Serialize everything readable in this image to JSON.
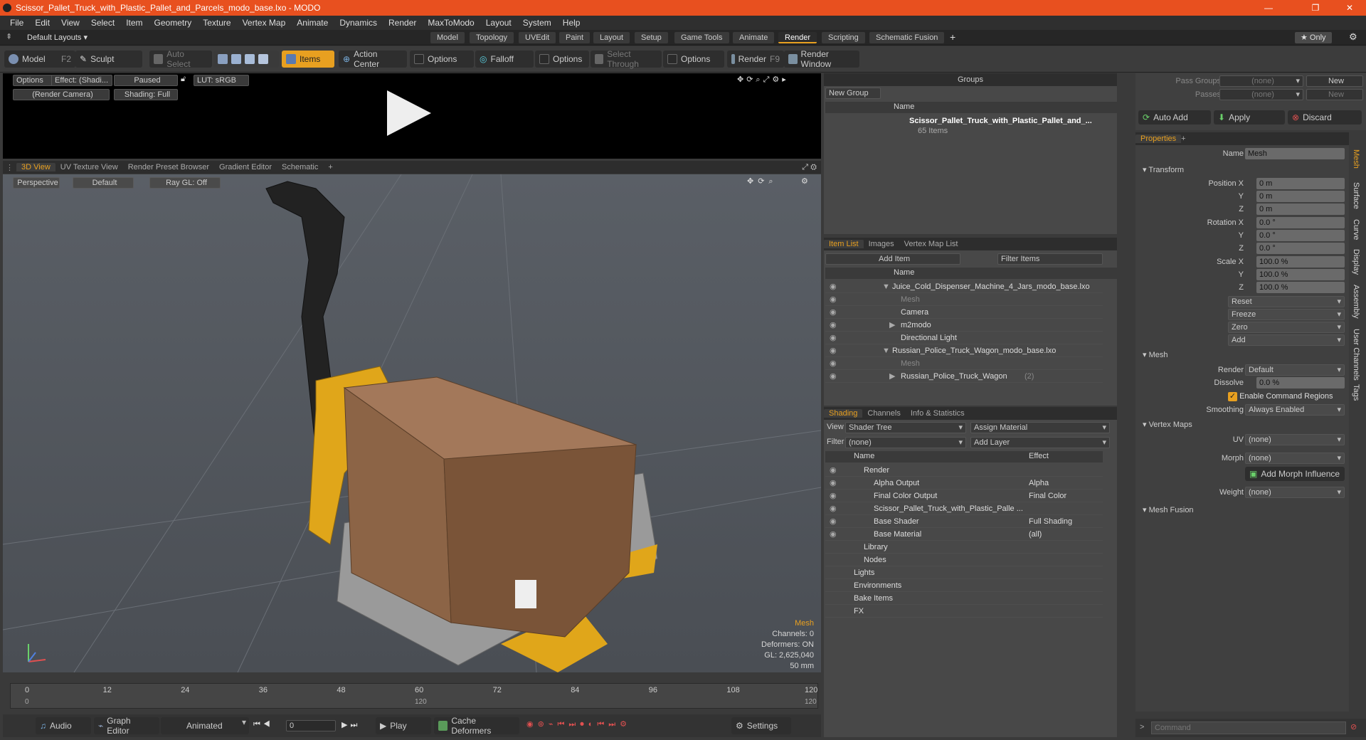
{
  "window": {
    "title": "Scissor_Pallet_Truck_with_Plastic_Pallet_and_Parcels_modo_base.lxo - MODO",
    "min": "—",
    "max": "❐",
    "close": "✕"
  },
  "menu": [
    "File",
    "Edit",
    "View",
    "Select",
    "Item",
    "Geometry",
    "Texture",
    "Vertex Map",
    "Animate",
    "Dynamics",
    "Render",
    "MaxToModo",
    "Layout",
    "System",
    "Help"
  ],
  "layouts": {
    "default": "Default Layouts ▾",
    "tabs": [
      "Model",
      "Topology",
      "UVEdit",
      "Paint",
      "Layout",
      "Setup",
      "Game Tools",
      "Animate",
      "Render",
      "Scripting",
      "Schematic Fusion"
    ],
    "active": "Render",
    "add": "+",
    "only": "Only"
  },
  "toolbar": {
    "model": "Model",
    "model_key": "F2",
    "sculpt": "Sculpt",
    "auto_select": "Auto Select",
    "items": "Items",
    "action_center": "Action Center",
    "options1": "Options",
    "falloff": "Falloff",
    "options2": "Options",
    "select_through": "Select Through",
    "options3": "Options",
    "render": "Render",
    "render_key": "F9",
    "render_window": "Render Window"
  },
  "preview": {
    "options": "Options",
    "effect": "Effect: (Shadi...",
    "paused": "Paused",
    "lut": "LUT: sRGB",
    "camera": "(Render Camera)",
    "shading": "Shading: Full"
  },
  "viewtabs": {
    "tabs": [
      "3D View",
      "UV Texture View",
      "Render Preset Browser",
      "Gradient Editor",
      "Schematic"
    ],
    "active": "3D View",
    "add": "+"
  },
  "viewport": {
    "perspective": "Perspective",
    "default": "Default",
    "raygl": "Ray GL: Off",
    "info_title": "Mesh",
    "channels": "Channels: 0",
    "deformers": "Deformers: ON",
    "gl": "GL: 2,625,040",
    "lens": "50 mm"
  },
  "timeline": {
    "ticks": [
      "0",
      "12",
      "24",
      "36",
      "48",
      "60",
      "72",
      "84",
      "96",
      "108",
      "120"
    ],
    "sub_ticks": [
      "0",
      "120",
      "120"
    ]
  },
  "transport": {
    "audio": "Audio",
    "graph_editor": "Graph Editor",
    "animated": "Animated",
    "frame": "0",
    "play": "Play",
    "cache": "Cache Deformers",
    "settings": "Settings"
  },
  "groups": {
    "title": "Groups",
    "new_group": "New Group",
    "col_name": "Name",
    "item": "Scissor_Pallet_Truck_with_Plastic_Pallet_and_...",
    "count": "65 Items"
  },
  "itemlist": {
    "tabs": [
      "Item List",
      "Images",
      "Vertex Map List"
    ],
    "active": "Item List",
    "add_item": "Add Item",
    "filter": "Filter Items",
    "col_name": "Name",
    "rows": [
      {
        "label": "Juice_Cold_Dispenser_Machine_4_Jars_modo_base.lxo",
        "indent": 0,
        "arrow": "▼"
      },
      {
        "label": "Mesh",
        "indent": 2,
        "dim": true
      },
      {
        "label": "Camera",
        "indent": 2
      },
      {
        "label": "m2modo",
        "indent": 2,
        "arrow": "▶"
      },
      {
        "label": "Directional Light",
        "indent": 2
      },
      {
        "label": "Russian_Police_Truck_Wagon_modo_base.lxo",
        "indent": 0,
        "arrow": "▼"
      },
      {
        "label": "Mesh",
        "indent": 2,
        "dim": true
      },
      {
        "label": "Russian_Police_Truck_Wagon",
        "indent": 2,
        "arrow": "▶",
        "suffix": "(2)"
      }
    ]
  },
  "shading": {
    "tabs": [
      "Shading",
      "Channels",
      "Info & Statistics"
    ],
    "active": "Shading",
    "view_label": "View",
    "view_value": "Shader Tree",
    "assign": "Assign Material",
    "filter_label": "Filter",
    "filter_value": "(none)",
    "add_layer": "Add Layer",
    "col_name": "Name",
    "col_effect": "Effect",
    "rows": [
      {
        "name": "Render",
        "effect": "",
        "indent": 1
      },
      {
        "name": "Alpha Output",
        "effect": "Alpha",
        "indent": 2
      },
      {
        "name": "Final Color Output",
        "effect": "Final Color",
        "indent": 2
      },
      {
        "name": "Scissor_Pallet_Truck_with_Plastic_Palle ...",
        "effect": "",
        "indent": 2
      },
      {
        "name": "Base Shader",
        "effect": "Full Shading",
        "indent": 2
      },
      {
        "name": "Base Material",
        "effect": "(all)",
        "indent": 2
      },
      {
        "name": "Library",
        "effect": "",
        "indent": 1
      },
      {
        "name": "Nodes",
        "effect": "",
        "indent": 1
      },
      {
        "name": "Lights",
        "effect": "",
        "indent": 0
      },
      {
        "name": "Environments",
        "effect": "",
        "indent": 0
      },
      {
        "name": "Bake Items",
        "effect": "",
        "indent": 0
      },
      {
        "name": "FX",
        "effect": "",
        "indent": 0
      }
    ]
  },
  "passes": {
    "pass_groups": "Pass Groups",
    "passes": "Passes",
    "none": "(none)",
    "new": "New",
    "auto_add": "Auto Add",
    "apply": "Apply",
    "discard": "Discard"
  },
  "properties": {
    "tab": "Properties",
    "name_label": "Name",
    "name_value": "Mesh",
    "transform": "Transform",
    "pos": [
      "0 m",
      "0 m",
      "0 m"
    ],
    "rot": [
      "0.0 °",
      "0.0 °",
      "0.0 °"
    ],
    "scale": [
      "100.0 %",
      "100.0 %",
      "100.0 %"
    ],
    "pos_label": "Position X",
    "rot_label": "Rotation X",
    "scale_label": "Scale X",
    "y": "Y",
    "z": "Z",
    "reset": "Reset",
    "freeze": "Freeze",
    "zero": "Zero",
    "add": "Add",
    "mesh": "Mesh",
    "render_label": "Render",
    "render_value": "Default",
    "dissolve_label": "Dissolve",
    "dissolve_value": "0.0 %",
    "enable_cmd": "Enable Command Regions",
    "smoothing_label": "Smoothing",
    "smoothing_value": "Always Enabled",
    "vertex_maps": "Vertex Maps",
    "uv_label": "UV",
    "uv_value": "(none)",
    "morph_label": "Morph",
    "morph_value": "(none)",
    "add_morph": "Add Morph Influence",
    "weight_label": "Weight",
    "weight_value": "(none)",
    "mesh_fusion": "Mesh Fusion",
    "side_tabs": [
      "Mesh",
      "Surface",
      "Curve",
      "Display",
      "Assembly",
      "User Channels",
      "Tags"
    ]
  },
  "command": {
    "placeholder": "Command"
  }
}
